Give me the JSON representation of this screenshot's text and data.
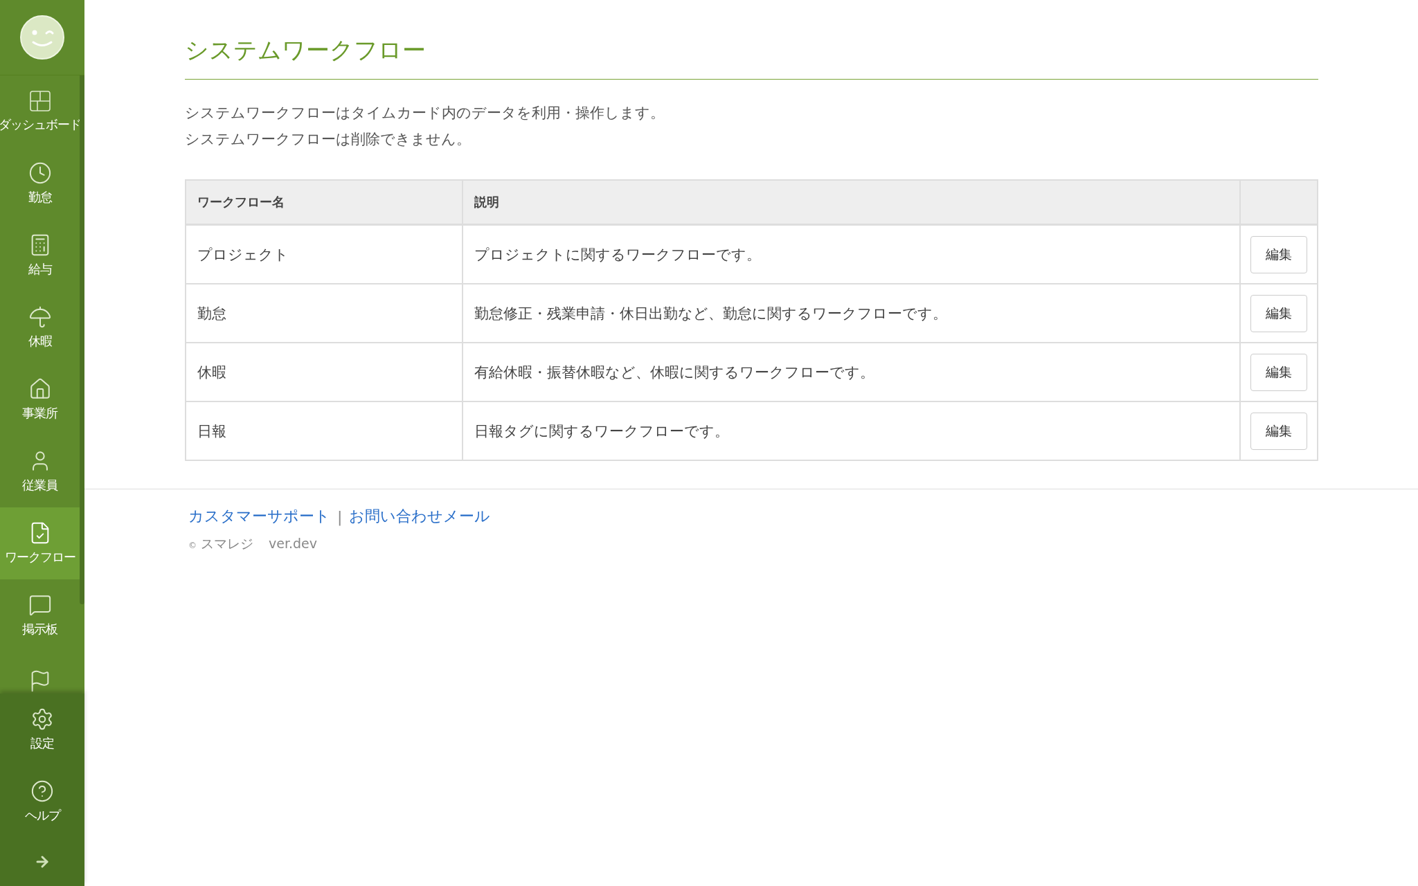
{
  "sidebar": {
    "items": [
      {
        "label": "ダッシュボード",
        "selected": false
      },
      {
        "label": "勤怠",
        "selected": false
      },
      {
        "label": "給与",
        "selected": false
      },
      {
        "label": "休暇",
        "selected": false
      },
      {
        "label": "事業所",
        "selected": false
      },
      {
        "label": "従業員",
        "selected": false
      },
      {
        "label": "ワークフロー",
        "selected": true
      },
      {
        "label": "掲示板",
        "selected": false
      },
      {
        "selected": false
      }
    ],
    "bottom_items": [
      {
        "label": "設定"
      },
      {
        "label": "ヘルプ"
      }
    ]
  },
  "page": {
    "title": "システムワークフロー",
    "description": [
      "システムワークフローはタイムカード内のデータを利用・操作します。",
      "システムワークフローは削除できません。"
    ]
  },
  "table": {
    "columns": [
      "ワークフロー名",
      "説明"
    ],
    "rows": [
      {
        "name": "プロジェクト",
        "description": "プロジェクトに関するワークフローです。",
        "action": "編集"
      },
      {
        "name": "勤怠",
        "description": "勤怠修正・残業申請・休日出勤など、勤怠に関するワークフローです。",
        "action": "編集"
      },
      {
        "name": "休暇",
        "description": "有給休暇・振替休暇など、休暇に関するワークフローです。",
        "action": "編集"
      },
      {
        "name": "日報",
        "description": "日報タグに関するワークフローです。",
        "action": "編集"
      }
    ]
  },
  "footer": {
    "links": [
      "カスタマーサポート",
      "お問い合わせメール"
    ],
    "separator": "|",
    "copyright_mark": "©",
    "brand": "スマレジ",
    "version": "ver.dev"
  }
}
